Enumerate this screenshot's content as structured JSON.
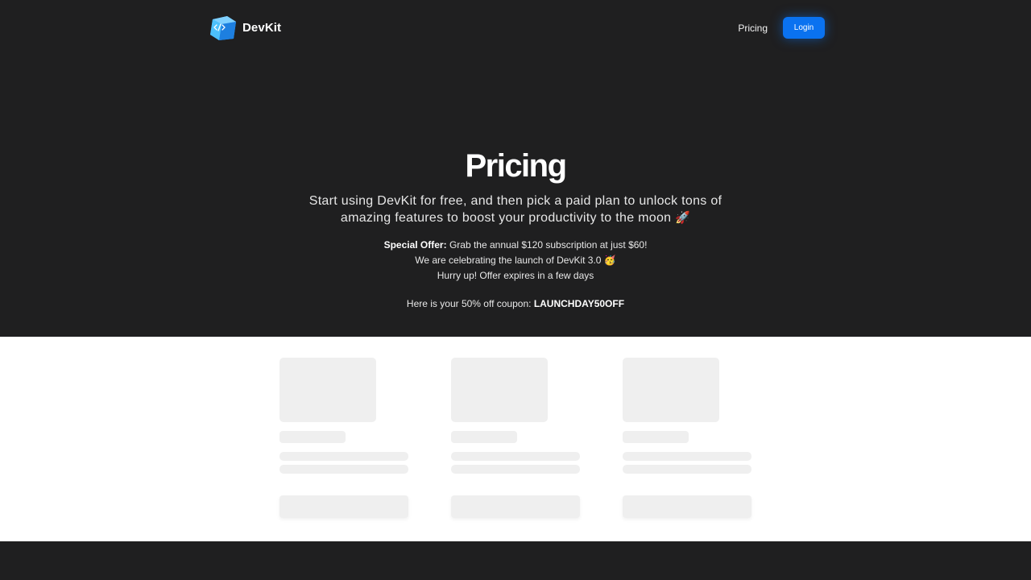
{
  "brand": {
    "name": "DevKit",
    "icon": "code-cube-icon"
  },
  "nav": {
    "pricing_label": "Pricing",
    "login_label": "Login"
  },
  "hero": {
    "title": "Pricing",
    "subtitle": "Start using DevKit for free, and then pick a paid plan to unlock tons of amazing features to boost your productivity to the moon",
    "subtitle_emoji": "🚀",
    "offer_label": "Special Offer:",
    "offer_text": "Grab the annual $120 subscription at just $60!",
    "celebration_text": "We are celebrating the launch of DevKit 3.0",
    "celebration_emoji": "🥳",
    "hurry_text": "Hurry up! Offer expires in a few days",
    "coupon_label": "Here is your 50% off coupon:",
    "coupon_code": "LAUNCHDAY50OFF"
  },
  "colors": {
    "background": "#1f1f20",
    "accent": "#0a72f0",
    "skeleton": "#efefef"
  }
}
